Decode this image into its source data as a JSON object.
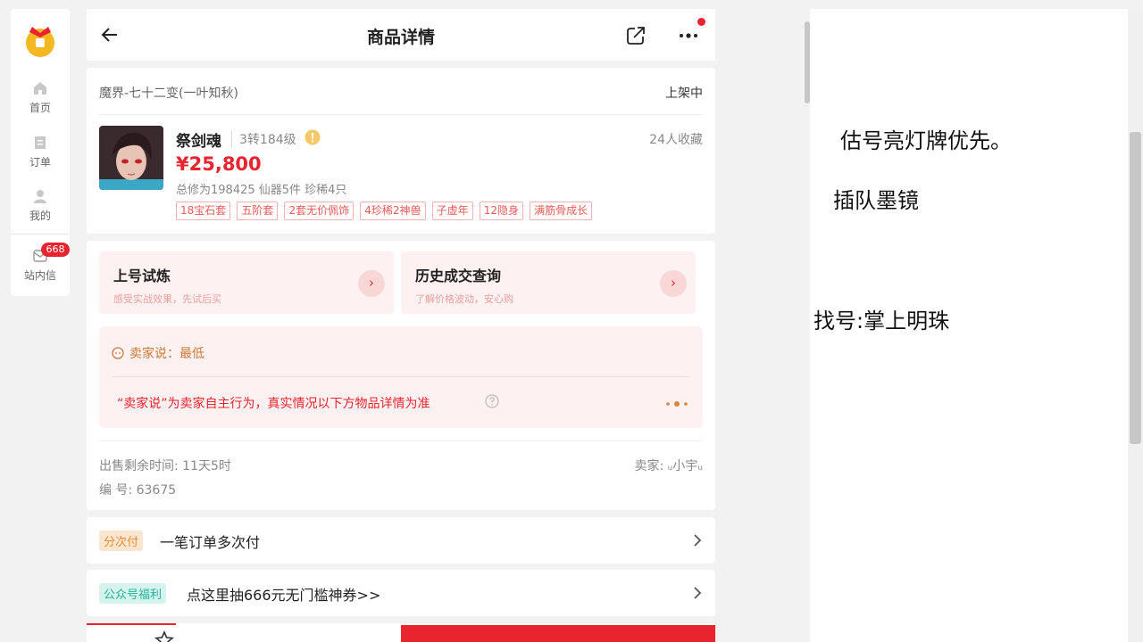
{
  "nav": {
    "items": [
      {
        "label": "首页",
        "icon": "home-icon"
      },
      {
        "label": "订单",
        "icon": "order-icon"
      },
      {
        "label": "我的",
        "icon": "user-icon"
      },
      {
        "label": "站内信",
        "icon": "message-icon",
        "badge": "668"
      }
    ]
  },
  "header": {
    "title": "商品详情"
  },
  "product": {
    "server": "魔界-七十二变(一叶知秋)",
    "status": "上架中",
    "role_name": "祭剑魂",
    "role_level": "3转184级",
    "favorites": "24人收藏",
    "price": "¥25,800",
    "stats": "总修为198425  仙器5件  珍稀4只",
    "tags": [
      "18宝石套",
      "五阶套",
      "2套无价佩饰",
      "4珍稀2神兽",
      "子虚年",
      "12隐身",
      "满筋骨成长"
    ]
  },
  "promos": [
    {
      "title": "上号试炼",
      "subtitle": "感受实战效果，先试后买"
    },
    {
      "title": "历史成交查询",
      "subtitle": "了解价格波动，安心购"
    }
  ],
  "seller_say": {
    "line1": "卖家说：最低",
    "line2": "“卖家说”为卖家自主行为，真实情况以下方物品详情为准"
  },
  "meta": {
    "sell_time": "出售剩余时间: 11天5时",
    "seller": "卖家: ᵤ小宇ᵤ",
    "code": "编 号: 63675"
  },
  "rows": [
    {
      "tag": "分次付",
      "text": "一笔订单多次付"
    },
    {
      "tag": "公众号福利",
      "text": "点这里抽666元无门槛神券>>"
    }
  ],
  "notes": [
    "估号亮灯牌优先。",
    "插队墨镜",
    "找号:掌上明珠"
  ],
  "colors": {
    "accent": "#e8242f",
    "seller_say": "#c97a3a"
  }
}
